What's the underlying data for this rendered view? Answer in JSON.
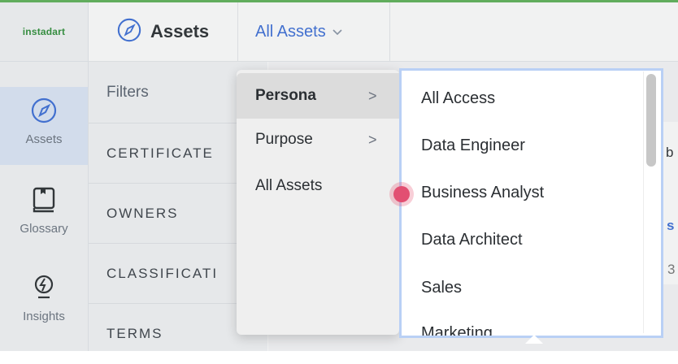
{
  "brand": {
    "logo_text": "instadart",
    "accent": "#3d6fd8",
    "green": "#5fb35a"
  },
  "sidebar": {
    "items": [
      {
        "label": "Assets",
        "icon": "compass-icon",
        "active": true
      },
      {
        "label": "Glossary",
        "icon": "book-icon",
        "active": false
      },
      {
        "label": "Insights",
        "icon": "lightbulb-icon",
        "active": false
      }
    ]
  },
  "header": {
    "title": "Assets",
    "title_icon": "compass-icon",
    "view_selector": "All Assets",
    "view_selector_icon": "chevron-down-icon"
  },
  "filters": {
    "title": "Filters",
    "items": [
      "CERTIFICATE",
      "OWNERS",
      "CLASSIFICATI",
      "TERMS"
    ]
  },
  "background_peek": {
    "b": "b",
    "s": "s",
    "three": "3"
  },
  "dropdown": {
    "items": [
      {
        "label": "Persona",
        "has_submenu": true,
        "selected": true
      },
      {
        "label": "Purpose",
        "has_submenu": true,
        "selected": false
      },
      {
        "label": "All Assets",
        "has_submenu": false,
        "selected": false
      }
    ],
    "arrow": ">"
  },
  "submenu": {
    "items": [
      "All Access",
      "Data Engineer",
      "Business Analyst",
      "Data Architect",
      "Sales",
      "Marketing"
    ],
    "hovered": "Business Analyst"
  }
}
